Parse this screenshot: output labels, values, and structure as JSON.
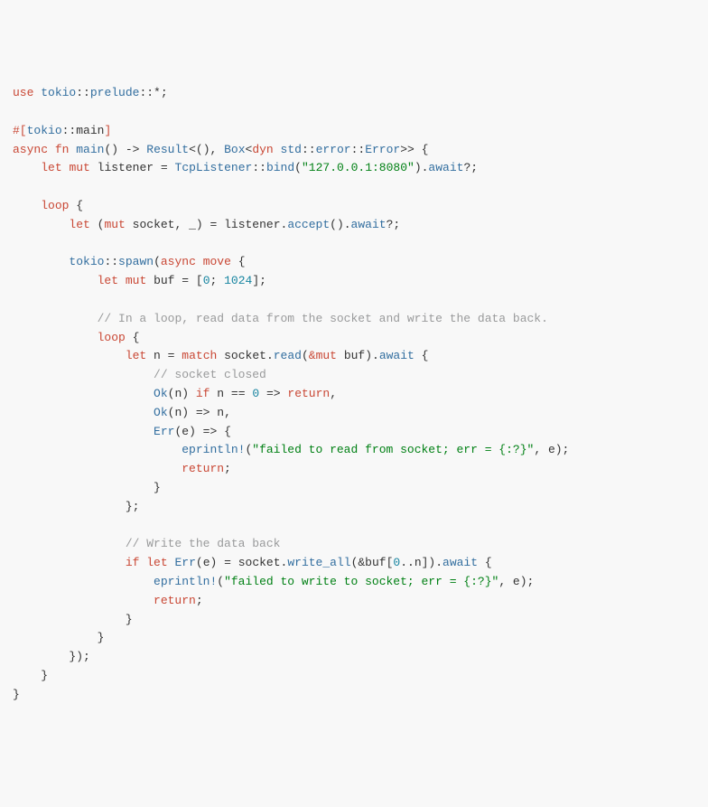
{
  "code": {
    "l1": {
      "kw_use": "use",
      "ns_tokio": "tokio",
      "ns_prelude": "prelude"
    },
    "l3": {
      "attr_open": "#[",
      "ns_tokio": "tokio",
      "ident_main": "main",
      "attr_close": "]"
    },
    "l4": {
      "kw_async": "async",
      "kw_fn": "fn",
      "fn_main": "main",
      "ty_result": "Result",
      "kw_dyn": "dyn",
      "ns_std": "std",
      "ns_error": "error",
      "ty_error": "Error",
      "ty_box": "Box"
    },
    "l5": {
      "kw_let": "let",
      "kw_mut": "mut",
      "ident_listener": "listener",
      "ty_tcplistener": "TcpListener",
      "fn_bind": "bind",
      "str_addr": "\"127.0.0.1:8080\"",
      "kw_await": "await"
    },
    "l7": {
      "kw_loop": "loop"
    },
    "l8": {
      "kw_let": "let",
      "kw_mut": "mut",
      "ident_socket": "socket",
      "ident_listener": "listener",
      "fn_accept": "accept",
      "kw_await": "await"
    },
    "l10": {
      "ns_tokio": "tokio",
      "fn_spawn": "spawn",
      "kw_async": "async",
      "kw_move": "move"
    },
    "l11": {
      "kw_let": "let",
      "kw_mut": "mut",
      "ident_buf": "buf",
      "num_0": "0",
      "num_1024": "1024"
    },
    "l13": {
      "cm": "// In a loop, read data from the socket and write the data back."
    },
    "l14": {
      "kw_loop": "loop"
    },
    "l15": {
      "kw_let": "let",
      "ident_n": "n",
      "kw_match": "match",
      "ident_socket": "socket",
      "fn_read": "read",
      "kw_mut_ref": "&mut",
      "ident_buf": "buf",
      "kw_await": "await"
    },
    "l16": {
      "cm": "// socket closed"
    },
    "l17": {
      "ty_ok": "Ok",
      "ident_n": "n",
      "kw_if": "if",
      "num_0": "0",
      "kw_return": "return"
    },
    "l18": {
      "ty_ok": "Ok",
      "ident_n": "n"
    },
    "l19": {
      "ty_err": "Err",
      "ident_e": "e"
    },
    "l20": {
      "mac_eprintln": "eprintln!",
      "str_read": "\"failed to read from socket; err = {:?}\"",
      "ident_e": "e"
    },
    "l21": {
      "kw_return": "return"
    },
    "l25": {
      "cm": "// Write the data back"
    },
    "l26": {
      "kw_if": "if",
      "kw_let": "let",
      "ty_err": "Err",
      "ident_e": "e",
      "ident_socket": "socket",
      "fn_write_all": "write_all",
      "ident_buf": "buf",
      "num_0": "0",
      "ident_n": "n",
      "kw_await": "await"
    },
    "l27": {
      "mac_eprintln": "eprintln!",
      "str_write": "\"failed to write to socket; err = {:?}\"",
      "ident_e": "e"
    },
    "l28": {
      "kw_return": "return"
    }
  }
}
